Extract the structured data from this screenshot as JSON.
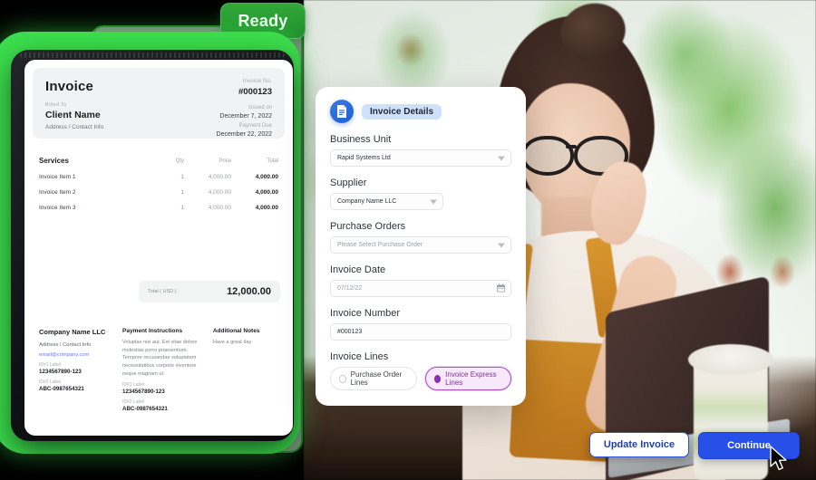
{
  "badge": {
    "label": "Ready"
  },
  "invoice_doc": {
    "title": "Invoice",
    "invoice_no_label": "Invoice No.",
    "invoice_no": "#000123",
    "billed_to_label": "Billed To",
    "client_name": "Client Name",
    "client_address": "Address / Contact Info",
    "issued_on_label": "Issued on",
    "issued_on": "December 7, 2022",
    "payment_due_label": "Payment Due",
    "payment_due": "December 22, 2022",
    "services_label": "Services",
    "columns": [
      "Qty",
      "Price",
      "Total"
    ],
    "rows": [
      {
        "name": "Invoice Item 1",
        "qty": "1",
        "price": "4,000.00",
        "total": "4,000.00"
      },
      {
        "name": "Invoice Item 2",
        "qty": "1",
        "price": "4,000.00",
        "total": "4,000.00"
      },
      {
        "name": "Invoice Item 3",
        "qty": "1",
        "price": "4,000.00",
        "total": "4,000.00"
      }
    ],
    "total_label": "Total ( USD )",
    "total_value": "12,000.00",
    "footer": {
      "company_name": "Company Name LLC",
      "company_address": "Address / Contact Info",
      "company_email": "email@company.com",
      "id1_label": "ID#1 Label",
      "id1_value": "1234567890-123",
      "id2_label": "ID#2 Label",
      "id2_value": "ABC-0987654321",
      "payment_instructions_title": "Payment Instructions",
      "payment_instructions_body": "Voluptas nisi aut. Est vitae dolore molestias porro praesentium. Tempore recusandae voluptatem necessitatibus corporis inventore neque magnam ut.",
      "pay_id1_label": "ID#1 Label",
      "pay_id1_value": "1234567890-123",
      "pay_id2_label": "ID#2 Label",
      "pay_id2_value": "ABC-0987654321",
      "additional_notes_title": "Additional Notes",
      "additional_notes_body": "Have a great day"
    }
  },
  "form": {
    "header_chip": "Invoice Details",
    "header_icon": "invoice-document-icon",
    "business_unit": {
      "label": "Business Unit",
      "value": "Rapid Systems Ltd"
    },
    "supplier": {
      "label": "Supplier",
      "value": "Company Name LLC"
    },
    "purchase_orders": {
      "label": "Purchase Orders",
      "placeholder": "Please Select Purchase Order"
    },
    "invoice_date": {
      "label": "Invoice Date",
      "value": "07/12/22"
    },
    "invoice_number": {
      "label": "Invoice Number",
      "value": "#000123"
    },
    "invoice_lines": {
      "label": "Invoice Lines",
      "options": [
        {
          "label": "Purchase Order Lines",
          "selected": false
        },
        {
          "label": "Invoice Express Lines",
          "selected": true
        }
      ]
    }
  },
  "actions": {
    "update_invoice": "Update Invoice",
    "continue": "Continue"
  },
  "colors": {
    "accent_blue": "#2650e8",
    "glow_green": "#3ce04e",
    "badge_green": "#1f8c2a",
    "select_purple": "#8d2fb5",
    "chip_blue": "#cfe0fb"
  }
}
